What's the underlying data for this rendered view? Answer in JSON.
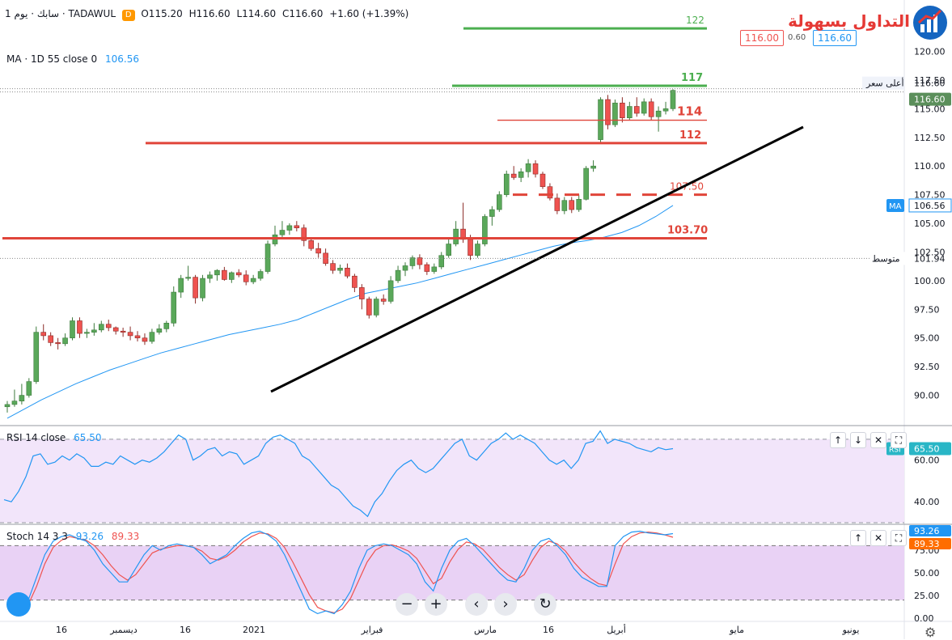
{
  "header": {
    "symbol_title": "سابك · يوم 1 · TADAWUL",
    "open": "O115.20",
    "high": "H116.60",
    "low": "L114.60",
    "close": "C116.60",
    "change": "+1.60 (+1.39%)",
    "delay_badge": "D",
    "sell_price": "116.00",
    "spread": "0.60",
    "buy_price": "116.60"
  },
  "logo": {
    "text": "التداول بسهولة"
  },
  "indicators": {
    "ma_label": "MA · 1D 55 close 0",
    "ma_value": "106.56",
    "rsi_label": "RSI 14 close",
    "rsi_value": "65.50",
    "stoch_label": "Stoch 14 3 3",
    "stoch_k": "93.26",
    "stoch_d": "89.33"
  },
  "price_axis_tags": {
    "high_label": "أعلى سعر",
    "high_value": "116.60",
    "last_value": "116.60",
    "ma_tag": "MA",
    "ma_value": "106.56",
    "avg_label": "متوسط",
    "avg_value": "101.94",
    "rsi_tag": "RSI",
    "rsi_value": "65.50",
    "k_value": "93.26",
    "d_value": "89.33"
  },
  "buttons": {
    "up": "↑",
    "down": "↓",
    "close": "✕",
    "maximize": "⛶",
    "zoom_out": "−",
    "zoom_in": "+",
    "prev": "‹",
    "next": "›",
    "reset": "↻"
  },
  "colors": {
    "up_candle": "#26a69a",
    "up_candle_fill": "#5aa85a",
    "down_candle": "#ef5350",
    "ma_line": "#2196f3",
    "resistance_red": "#e0453a",
    "resistance_green": "#4caf50",
    "rsi_line": "#2196f3",
    "stoch_k": "#2196f3",
    "stoch_d": "#ef5350",
    "rsi_bg": "#f2e5fa",
    "stoch_bg": "#e9d2f5"
  },
  "chart_data": [
    {
      "type": "candlestick",
      "title": "",
      "xlabel": "",
      "ylabel": "",
      "ylim": [
        87.5,
        124.2
      ],
      "y_ticks": [
        90,
        92.5,
        95,
        97.5,
        100,
        102.5,
        105,
        107.5,
        110,
        112.5,
        115,
        117.5,
        120,
        122.5
      ],
      "x_ticks": [
        "16",
        "ديسمبر",
        "16",
        "2021",
        "فبراير",
        "مارس",
        "16",
        "أبريل",
        "مايو",
        "يونيو"
      ],
      "candles": [
        [
          89.0,
          89.5,
          88.5,
          89.2
        ],
        [
          89.2,
          90.5,
          89.0,
          89.5
        ],
        [
          89.5,
          91.0,
          89.2,
          90.0
        ],
        [
          90.0,
          91.5,
          89.8,
          91.2
        ],
        [
          91.2,
          96.0,
          91.0,
          95.5
        ],
        [
          95.5,
          96.2,
          94.8,
          95.2
        ],
        [
          95.2,
          95.5,
          94.3,
          94.6
        ],
        [
          94.6,
          95.0,
          94.0,
          94.5
        ],
        [
          94.5,
          95.4,
          94.3,
          95.0
        ],
        [
          95.0,
          96.8,
          94.8,
          96.5
        ],
        [
          96.5,
          96.8,
          95.0,
          95.4
        ],
        [
          95.4,
          95.8,
          95.0,
          95.5
        ],
        [
          95.5,
          96.3,
          95.2,
          95.7
        ],
        [
          95.7,
          96.5,
          95.5,
          96.2
        ],
        [
          96.2,
          96.6,
          95.6,
          95.9
        ],
        [
          95.9,
          96.0,
          95.3,
          95.6
        ],
        [
          95.6,
          95.9,
          95.1,
          95.5
        ],
        [
          95.5,
          96.0,
          94.8,
          95.2
        ],
        [
          95.2,
          95.6,
          94.7,
          95.0
        ],
        [
          95.0,
          95.4,
          94.4,
          94.7
        ],
        [
          94.7,
          95.8,
          94.5,
          95.5
        ],
        [
          95.5,
          96.2,
          95.3,
          95.8
        ],
        [
          95.8,
          96.5,
          95.5,
          96.3
        ],
        [
          96.3,
          99.5,
          96.0,
          99.0
        ],
        [
          99.0,
          100.5,
          98.5,
          100.2
        ],
        [
          100.2,
          101.3,
          100.0,
          100.3
        ],
        [
          100.3,
          100.5,
          98.0,
          98.5
        ],
        [
          98.5,
          100.5,
          98.2,
          100.2
        ],
        [
          100.2,
          100.8,
          99.8,
          100.5
        ],
        [
          100.5,
          101.0,
          100.0,
          100.9
        ],
        [
          100.9,
          101.2,
          100.0,
          100.1
        ],
        [
          100.1,
          100.8,
          99.8,
          100.7
        ],
        [
          100.7,
          101.0,
          100.3,
          100.5
        ],
        [
          100.5,
          100.9,
          99.6,
          99.9
        ],
        [
          99.9,
          100.5,
          99.7,
          100.2
        ],
        [
          100.2,
          101.0,
          100.0,
          100.8
        ],
        [
          100.8,
          103.5,
          100.6,
          103.2
        ],
        [
          103.2,
          104.8,
          103.0,
          104.0
        ],
        [
          104.0,
          105.2,
          103.8,
          104.4
        ],
        [
          104.4,
          105.0,
          104.0,
          104.8
        ],
        [
          104.8,
          105.2,
          104.3,
          104.6
        ],
        [
          104.6,
          104.9,
          103.0,
          103.5
        ],
        [
          103.5,
          103.8,
          102.6,
          102.8
        ],
        [
          102.8,
          103.3,
          102.0,
          102.4
        ],
        [
          102.4,
          102.8,
          101.3,
          101.5
        ],
        [
          101.5,
          101.8,
          100.6,
          100.9
        ],
        [
          100.9,
          101.4,
          100.6,
          101.1
        ],
        [
          101.1,
          101.5,
          100.2,
          100.4
        ],
        [
          100.4,
          100.6,
          99.0,
          99.4
        ],
        [
          99.4,
          99.7,
          97.5,
          98.4
        ],
        [
          98.4,
          98.6,
          96.7,
          97.0
        ],
        [
          97.0,
          98.6,
          96.8,
          98.4
        ],
        [
          98.4,
          98.8,
          97.9,
          98.2
        ],
        [
          98.2,
          100.4,
          98.0,
          100.0
        ],
        [
          100.0,
          101.3,
          99.8,
          100.9
        ],
        [
          100.9,
          101.6,
          100.4,
          101.3
        ],
        [
          101.3,
          102.2,
          101.0,
          102.0
        ],
        [
          102.0,
          102.3,
          101.0,
          101.4
        ],
        [
          101.4,
          101.6,
          100.5,
          100.8
        ],
        [
          100.8,
          101.5,
          100.6,
          101.2
        ],
        [
          101.2,
          102.5,
          101.0,
          102.2
        ],
        [
          102.2,
          103.6,
          102.0,
          103.2
        ],
        [
          103.2,
          105.2,
          103.0,
          104.5
        ],
        [
          104.5,
          106.8,
          103.3,
          103.6
        ],
        [
          103.6,
          104.0,
          101.8,
          102.2
        ],
        [
          102.2,
          103.5,
          102.0,
          103.2
        ],
        [
          103.2,
          105.8,
          103.0,
          105.6
        ],
        [
          105.6,
          106.5,
          104.8,
          106.2
        ],
        [
          106.2,
          107.8,
          106.0,
          107.5
        ],
        [
          107.5,
          109.6,
          107.3,
          109.3
        ],
        [
          109.3,
          110.0,
          108.8,
          109.0
        ],
        [
          109.0,
          109.8,
          108.6,
          109.5
        ],
        [
          109.5,
          110.6,
          109.0,
          110.2
        ],
        [
          110.2,
          110.5,
          109.0,
          109.3
        ],
        [
          109.3,
          109.5,
          108.0,
          108.2
        ],
        [
          108.2,
          108.5,
          107.0,
          107.2
        ],
        [
          107.2,
          107.6,
          105.8,
          106.1
        ],
        [
          106.1,
          107.3,
          105.8,
          107.0
        ],
        [
          107.0,
          107.3,
          105.9,
          106.2
        ],
        [
          106.2,
          107.5,
          106.0,
          107.1
        ],
        [
          107.1,
          110.0,
          107.0,
          109.8
        ],
        [
          109.8,
          110.5,
          109.5,
          110.0
        ],
        [
          112.3,
          116.0,
          112.0,
          115.8
        ],
        [
          115.8,
          116.2,
          113.2,
          113.6
        ],
        [
          113.6,
          115.8,
          113.4,
          115.5
        ],
        [
          115.5,
          116.0,
          113.8,
          114.2
        ],
        [
          114.2,
          115.6,
          114.0,
          115.2
        ],
        [
          115.2,
          116.0,
          114.3,
          114.6
        ],
        [
          114.6,
          115.9,
          114.4,
          115.6
        ],
        [
          115.6,
          115.9,
          114.0,
          114.3
        ],
        [
          114.3,
          115.2,
          113.0,
          114.8
        ],
        [
          114.8,
          115.6,
          114.5,
          115.0
        ],
        [
          115.0,
          116.7,
          114.8,
          116.6
        ]
      ],
      "series": [
        {
          "name": "MA · 1D 55 close 0",
          "values": [
            88.0,
            88.8,
            89.6,
            90.3,
            91.0,
            91.6,
            92.2,
            92.7,
            93.2,
            93.7,
            94.1,
            94.5,
            94.9,
            95.3,
            95.6,
            95.9,
            96.2,
            96.6,
            97.2,
            97.8,
            98.4,
            98.9,
            99.2,
            99.5,
            99.8,
            100.2,
            100.6,
            101.0,
            101.4,
            101.8,
            102.2,
            102.6,
            103.0,
            103.3,
            103.5,
            103.8,
            104.2,
            104.8,
            105.6,
            106.56
          ]
        }
      ],
      "annotations": [
        {
          "label": "122",
          "y": 122
        },
        {
          "label": "117",
          "y": 117
        },
        {
          "label": "114",
          "y": 114
        },
        {
          "label": "112",
          "y": 112
        },
        {
          "label": "107.50",
          "y": 107.5
        },
        {
          "label": "103.70",
          "y": 103.7
        }
      ]
    },
    {
      "type": "line",
      "title": "",
      "ylim": [
        30,
        75
      ],
      "y_ticks": [
        40,
        60
      ],
      "series": [
        {
          "name": "RSI 14 close",
          "values": [
            41,
            40,
            45,
            52,
            62,
            63,
            58,
            59,
            62,
            60,
            63,
            61,
            57,
            57,
            59,
            58,
            62,
            60,
            58,
            60,
            59,
            61,
            64,
            68,
            72,
            70,
            60,
            62,
            65,
            66,
            62,
            64,
            63,
            58,
            60,
            62,
            68,
            71,
            72,
            70,
            68,
            62,
            60,
            56,
            52,
            48,
            46,
            42,
            38,
            36,
            33,
            40,
            44,
            50,
            55,
            58,
            60,
            56,
            54,
            56,
            60,
            64,
            68,
            70,
            62,
            60,
            64,
            68,
            70,
            73,
            70,
            72,
            70,
            68,
            64,
            60,
            58,
            60,
            56,
            60,
            68,
            69,
            74,
            68,
            70,
            69,
            68,
            66,
            65,
            64,
            66,
            65,
            65.5
          ]
        }
      ]
    },
    {
      "type": "line",
      "title": "",
      "ylim": [
        0,
        100
      ],
      "y_ticks": [
        0,
        25,
        50,
        75
      ],
      "series": [
        {
          "name": "%K",
          "values": [
            20,
            45,
            70,
            85,
            90,
            92,
            88,
            85,
            75,
            60,
            50,
            40,
            40,
            55,
            70,
            80,
            75,
            80,
            82,
            80,
            78,
            70,
            60,
            65,
            70,
            80,
            88,
            94,
            96,
            92,
            85,
            70,
            50,
            30,
            10,
            5,
            8,
            5,
            15,
            30,
            55,
            75,
            80,
            82,
            80,
            75,
            70,
            60,
            40,
            30,
            55,
            75,
            85,
            88,
            80,
            70,
            60,
            50,
            42,
            40,
            55,
            75,
            85,
            88,
            80,
            70,
            55,
            45,
            40,
            35,
            35,
            80,
            90,
            95,
            96,
            94,
            93,
            92,
            93.26
          ]
        },
        {
          "name": "%D",
          "values": [
            15,
            35,
            60,
            78,
            86,
            90,
            88,
            86,
            80,
            70,
            58,
            48,
            42,
            48,
            60,
            72,
            76,
            78,
            80,
            80,
            78,
            74,
            66,
            64,
            68,
            75,
            84,
            90,
            94,
            93,
            88,
            78,
            62,
            44,
            26,
            12,
            8,
            6,
            10,
            22,
            42,
            62,
            75,
            80,
            81,
            78,
            74,
            66,
            52,
            38,
            44,
            62,
            76,
            84,
            82,
            76,
            66,
            56,
            48,
            42,
            48,
            64,
            78,
            85,
            82,
            74,
            62,
            52,
            44,
            38,
            36,
            60,
            82,
            90,
            94,
            95,
            94,
            92,
            89.33
          ]
        }
      ]
    }
  ]
}
